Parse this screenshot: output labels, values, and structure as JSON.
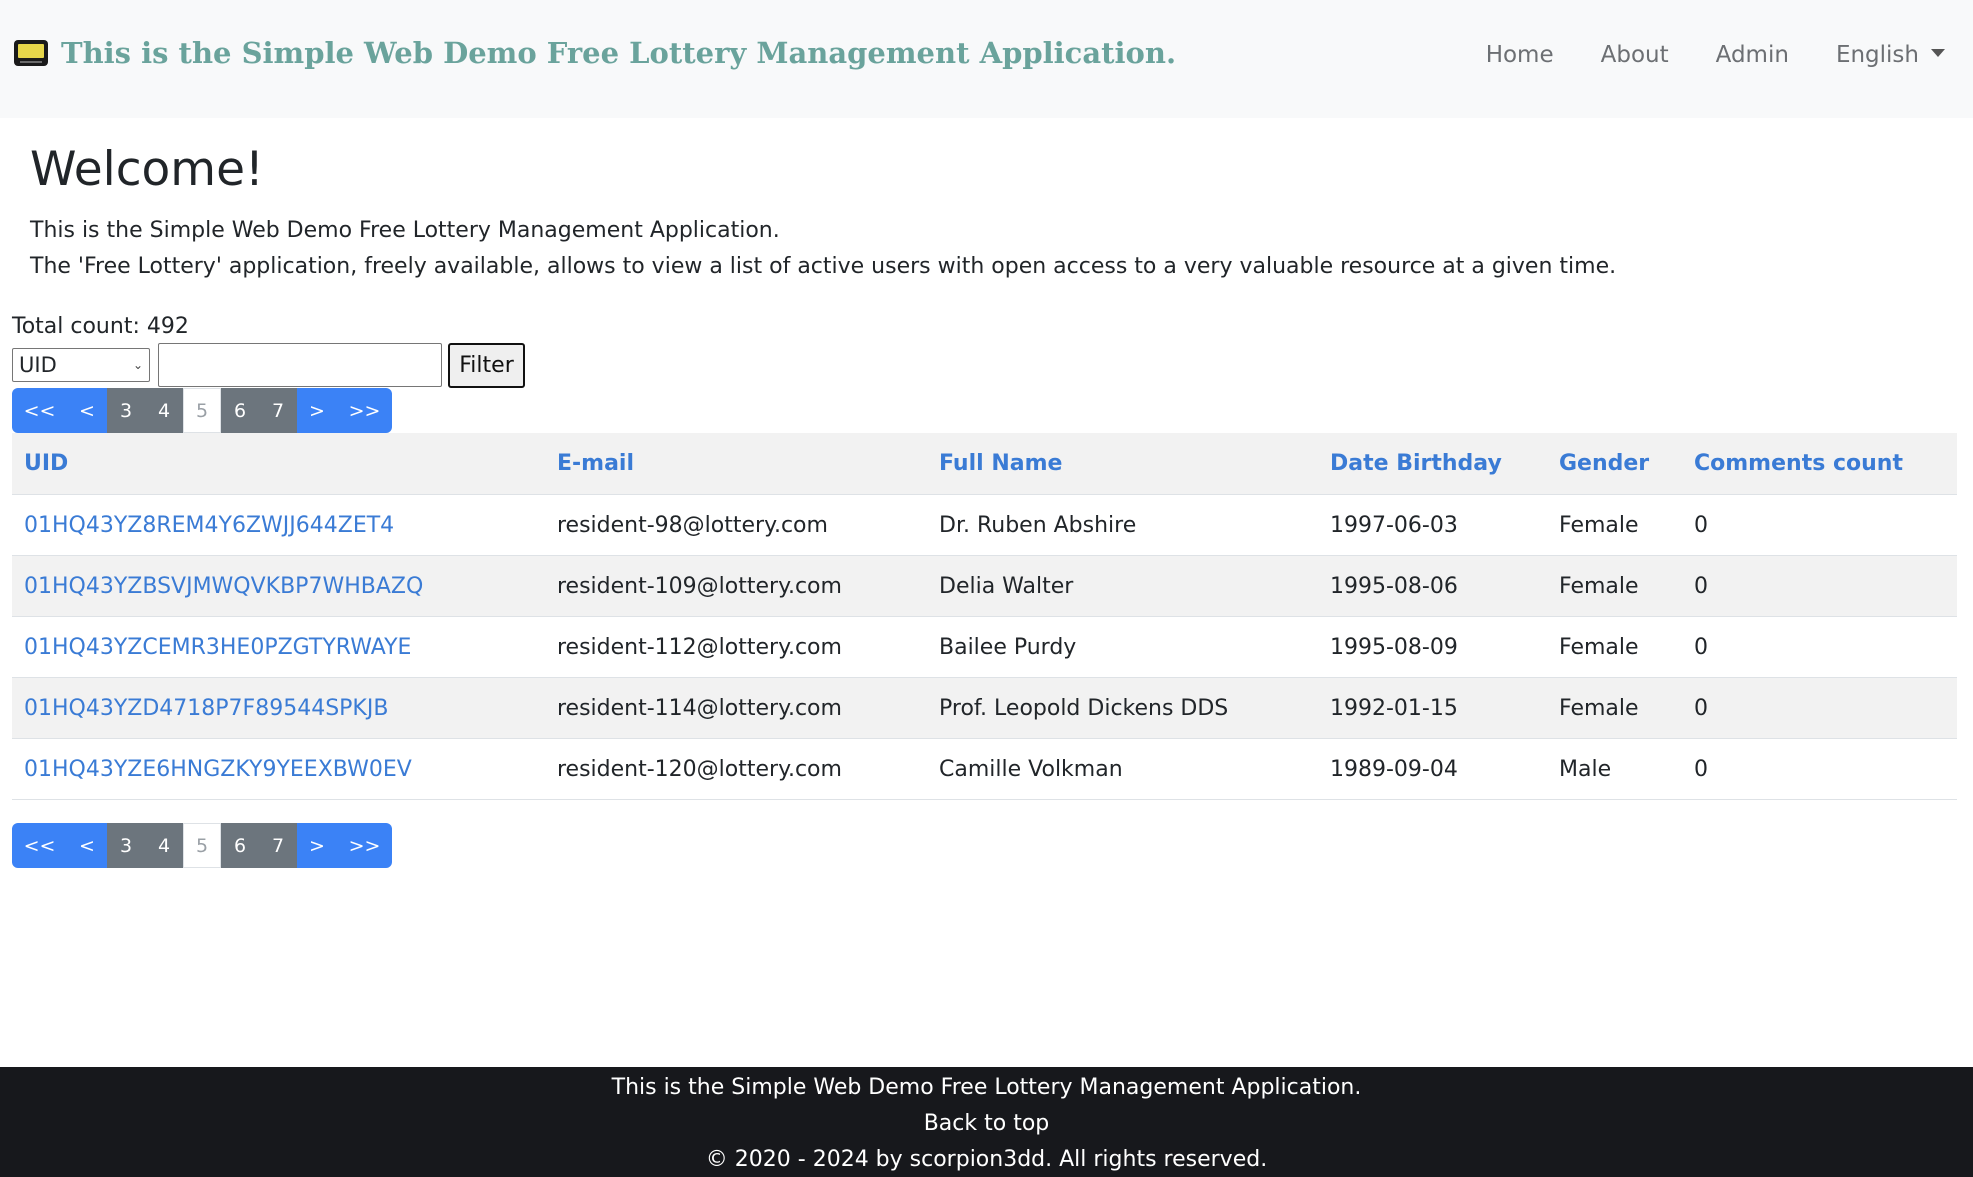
{
  "navbar": {
    "brand": "This is the Simple Web Demo Free Lottery Management Application.",
    "links": [
      "Home",
      "About",
      "Admin"
    ],
    "language": "English"
  },
  "welcome": {
    "title": "Welcome!",
    "line1": "This is the Simple Web Demo Free Lottery Management Application.",
    "line2": "The 'Free Lottery' application, freely available, allows to view a list of active users with open access to a very valuable resource at a given time."
  },
  "total_count_label": "Total count: 492",
  "filter": {
    "selected_field": "UID",
    "input_value": "",
    "button": "Filter"
  },
  "pagination": {
    "first": "<<",
    "prev": "<",
    "pages": [
      "3",
      "4",
      "5",
      "6",
      "7"
    ],
    "current": "5",
    "next": ">",
    "last": ">>"
  },
  "table": {
    "headers": [
      "UID",
      "E-mail",
      "Full Name",
      "Date Birthday",
      "Gender",
      "Comments count"
    ],
    "rows": [
      [
        "01HQ43YZ8REM4Y6ZWJJ644ZET4",
        "resident-98@lottery.com",
        "Dr. Ruben Abshire",
        "1997-06-03",
        "Female",
        "0"
      ],
      [
        "01HQ43YZBSVJMWQVKBP7WHBAZQ",
        "resident-109@lottery.com",
        "Delia Walter",
        "1995-08-06",
        "Female",
        "0"
      ],
      [
        "01HQ43YZCEMR3HE0PZGTYRWAYE",
        "resident-112@lottery.com",
        "Bailee Purdy",
        "1995-08-09",
        "Female",
        "0"
      ],
      [
        "01HQ43YZD4718P7F89544SPKJB",
        "resident-114@lottery.com",
        "Prof. Leopold Dickens DDS",
        "1992-01-15",
        "Female",
        "0"
      ],
      [
        "01HQ43YZE6HNGZKY9YEEXBW0EV",
        "resident-120@lottery.com",
        "Camille Volkman",
        "1989-09-04",
        "Male",
        "0"
      ]
    ]
  },
  "footer": {
    "line1": "This is the Simple Web Demo Free Lottery Management Application.",
    "back_to_top": "Back to top",
    "copyright": "© 2020 - 2024 by scorpion3dd. All rights reserved."
  }
}
